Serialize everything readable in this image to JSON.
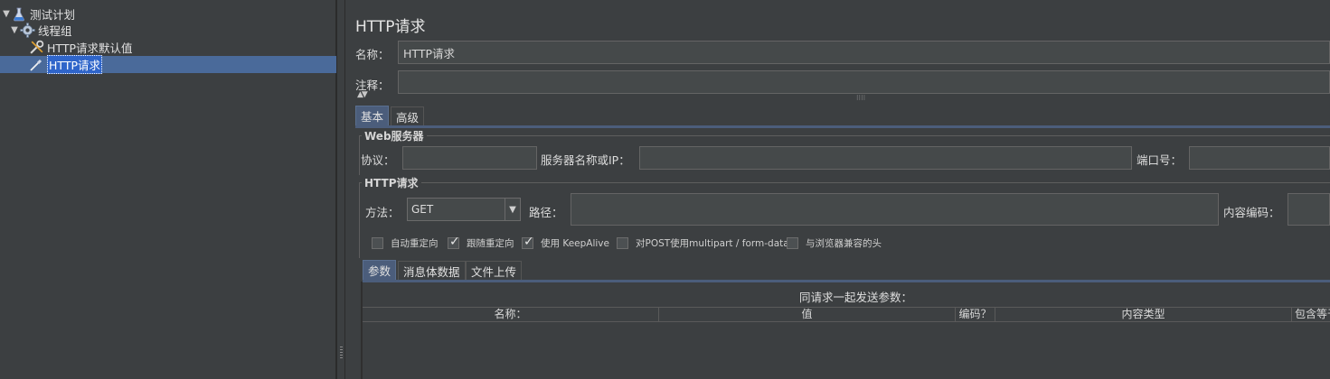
{
  "tree": {
    "items": [
      {
        "label": "测试计划",
        "icon": "flask-icon",
        "expanded": true
      },
      {
        "label": "线程组",
        "icon": "gear-icon",
        "expanded": true
      },
      {
        "label": "HTTP请求默认值",
        "icon": "wrench-icon"
      },
      {
        "label": "HTTP请求",
        "icon": "pipette-icon",
        "selected": true
      }
    ]
  },
  "panel": {
    "title": "HTTP请求",
    "name_label": "名称：",
    "name_value": "HTTP请求",
    "comment_label": "注释：",
    "comment_value": "",
    "collapse_arrows": "▲▼",
    "grip": "⁝⁝⁝⁝"
  },
  "tabs": {
    "basic": "基本",
    "advanced": "高级"
  },
  "web_server": {
    "title": "Web服务器",
    "protocol_label": "协议：",
    "protocol_value": "",
    "server_label": "服务器名称或IP：",
    "server_value": "",
    "port_label": "端口号：",
    "port_value": ""
  },
  "http_request": {
    "title": "HTTP请求",
    "method_label": "方法：",
    "method_value": "GET",
    "path_label": "路径：",
    "path_value": "",
    "encoding_label": "内容编码：",
    "encoding_value": ""
  },
  "options": [
    {
      "label": "自动重定向",
      "checked": false
    },
    {
      "label": "跟随重定向",
      "checked": true
    },
    {
      "label": "使用 KeepAlive",
      "checked": true
    },
    {
      "label": "对POST使用multipart / form-data",
      "checked": false
    },
    {
      "label": "与浏览器兼容的头",
      "checked": false
    }
  ],
  "sub_tabs": {
    "params": "参数",
    "body": "消息体数据",
    "files": "文件上传"
  },
  "params_table": {
    "caption": "同请求一起发送参数：",
    "columns": [
      "名称：",
      "值",
      "编码？",
      "内容类型",
      "包含等于？"
    ]
  },
  "colors": {
    "background": "#3c3f41",
    "selection": "#4a6a9a",
    "active_tab": "#4b5d7b"
  }
}
